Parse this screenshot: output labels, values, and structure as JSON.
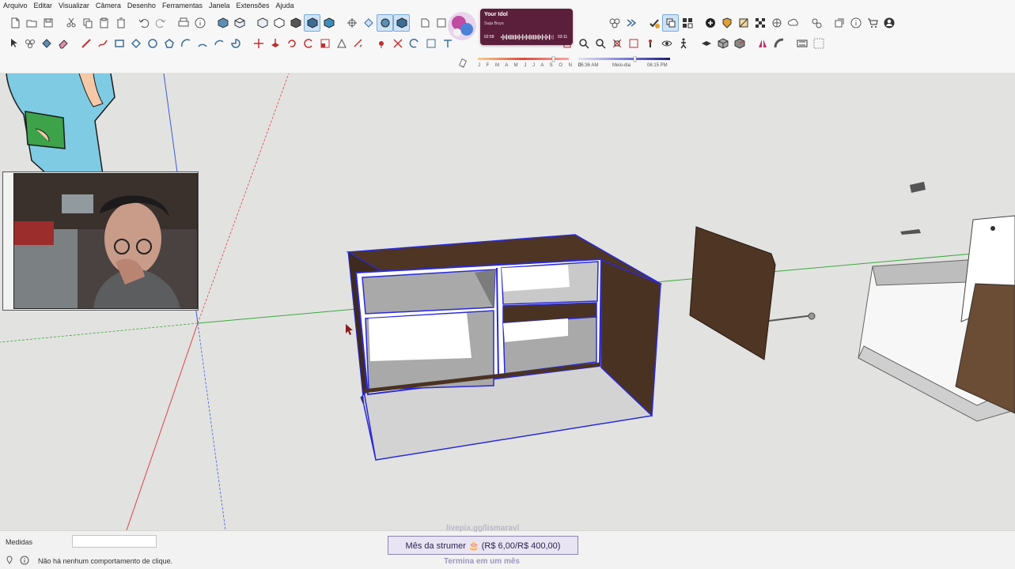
{
  "menu": {
    "items": [
      "Arquivo",
      "Editar",
      "Visualizar",
      "Câmera",
      "Desenho",
      "Ferramentas",
      "Janela",
      "Extensões",
      "Ajuda"
    ]
  },
  "toolbar_top_icons": [
    "new-file-icon",
    "open-folder-icon",
    "save-icon",
    "cut-icon",
    "copy-icon",
    "paste-icon",
    "delete-icon",
    "undo-icon",
    "redo-icon",
    "print-icon",
    "model-info-icon",
    "iso-view-icon",
    "top-view-icon",
    "front-view-icon",
    "right-view-icon",
    "back-view-icon",
    "left-view-icon",
    "bottom-view-icon",
    "xray-icon",
    "wireframe-icon",
    "hidden-line-icon",
    "shaded-icon",
    "textured-icon",
    "monochrome-icon",
    "section-plane-icon"
  ],
  "toolbar_right_icons": [
    "components-icon",
    "materials-icon",
    "styles-icon",
    "layers-icon",
    "scenes-icon",
    "solid-tools-icon",
    "outer-shell-icon",
    "intersect-icon",
    "union-icon",
    "add-location-icon",
    "warehouse-icon",
    "extension-warehouse-icon",
    "sandbox-icon",
    "cloud-upload-icon",
    "settings-icon",
    "send-to-layout-icon",
    "info-icon",
    "cart-icon",
    "account-icon"
  ],
  "toolbar_second_icons": [
    "select-icon",
    "make-component-icon",
    "paint-bucket-icon",
    "eraser-icon",
    "line-icon",
    "freehand-icon",
    "rectangle-icon",
    "rotated-rectangle-icon",
    "circle-icon",
    "polygon-icon",
    "arc-icon",
    "two-point-arc-icon",
    "three-point-arc-icon",
    "pie-icon",
    "move-icon",
    "push-pull-icon",
    "rotate-icon",
    "follow-me-icon",
    "scale-icon",
    "offset-icon",
    "tape-measure-icon",
    "dimension-icon",
    "protractor-icon",
    "text-icon",
    "axes-icon",
    "3d-text-icon",
    "orbit-icon",
    "pan-icon",
    "zoom-icon",
    "zoom-window-icon",
    "zoom-extents-icon",
    "previous-view-icon",
    "position-camera-icon",
    "look-around-icon",
    "walk-icon",
    "flat-shape-icon",
    "box-icon",
    "box-outline-icon",
    "mirror-icon",
    "sweep-icon",
    "text-box-icon",
    "grid-icon"
  ],
  "shadow": {
    "months": "J F M A M J J A S O N D",
    "time_start": "05:36 AM",
    "time_mid": "Meio-dia",
    "time_end": "06:15 PM"
  },
  "spotify": {
    "title": "Your Idol",
    "artist": "Saja Boys",
    "time_elapsed": "02:58",
    "time_total": "03:11",
    "progress_fraction": 0.93
  },
  "statusbar": {
    "measure_label": "Medidas",
    "message": "Não há nenhum comportamento de clique.",
    "goal_url": "livepix.gg/lismaravl",
    "goal_text": "Mês da strumer 🎂 (R$ 6,00/R$ 400,00)",
    "goal_sub": "Termina em um mês"
  },
  "colors": {
    "background": "#e2e2e1",
    "selection_blue": "#2a2ad8",
    "wood_dark": "#4e3524",
    "axis_red": "#d44",
    "axis_green": "#3ca83c",
    "axis_blue": "#3c5cd8",
    "spotify_card": "#5b1f3b",
    "goal_border": "#8c82b8"
  }
}
